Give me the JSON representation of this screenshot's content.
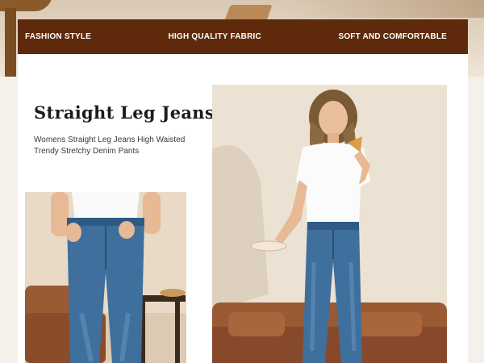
{
  "header": {
    "items": [
      "FASHION STYLE",
      "HIGH QUALITY FABRIC",
      "SOFT AND COMFORTABLE"
    ]
  },
  "product": {
    "title": "Straight Leg Jeans",
    "subtitle": "Womens Straight Leg Jeans High Waisted Trendy Stretchy Denim Pants"
  },
  "colors": {
    "header_bg": "#5e2a0b",
    "card_bg": "#ffffff",
    "denim": "#3f6f9c",
    "sofa": "#9a5a34"
  }
}
